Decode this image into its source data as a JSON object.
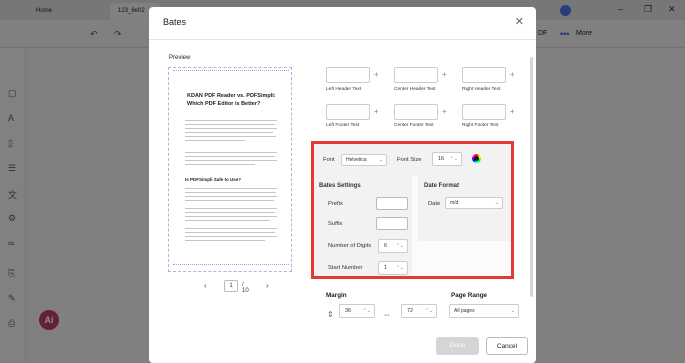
{
  "app": {
    "tabs": [
      {
        "label": "Home"
      },
      {
        "label": "123_8e02"
      }
    ],
    "toolbar": {
      "more_label": "More",
      "pdf_fragment": "DF"
    },
    "ai_badge": "Ai"
  },
  "dialog": {
    "title": "Bates",
    "preview_label": "Preview",
    "preview_doc": {
      "title": "KDAN PDF Reader vs. PDFSimpli: Which PDF Editor is Better?",
      "subheading": "Is PDFSimpli Safe to Use?"
    },
    "pager": {
      "current_page": "1",
      "total": "/ 10"
    },
    "header_labels": {
      "left": "Left Header Text",
      "center": "Center Header Text",
      "right": "Right Header Text"
    },
    "footer_labels": {
      "left": "Left Footer Text",
      "center": "Center Footer Text",
      "right": "Right Footer Text"
    },
    "font": {
      "label": "Font",
      "value": "Helvetica",
      "size_label": "Font Size",
      "size_value": "16"
    },
    "bates_settings": {
      "title": "Bates Settings",
      "prefix_label": "Prefix",
      "suffix_label": "Suffix",
      "digits_label": "Number of Digits",
      "digits_value": "6",
      "start_label": "Start Number",
      "start_value": "1"
    },
    "date_format": {
      "title": "Date Format",
      "label": "Date",
      "value": "m/d"
    },
    "margin": {
      "title": "Margin",
      "top_value": "36",
      "side_value": "72"
    },
    "page_range": {
      "title": "Page Range",
      "value": "All pages"
    },
    "buttons": {
      "done": "Done",
      "cancel": "Cancel"
    },
    "highlight_color": "#e53935"
  }
}
